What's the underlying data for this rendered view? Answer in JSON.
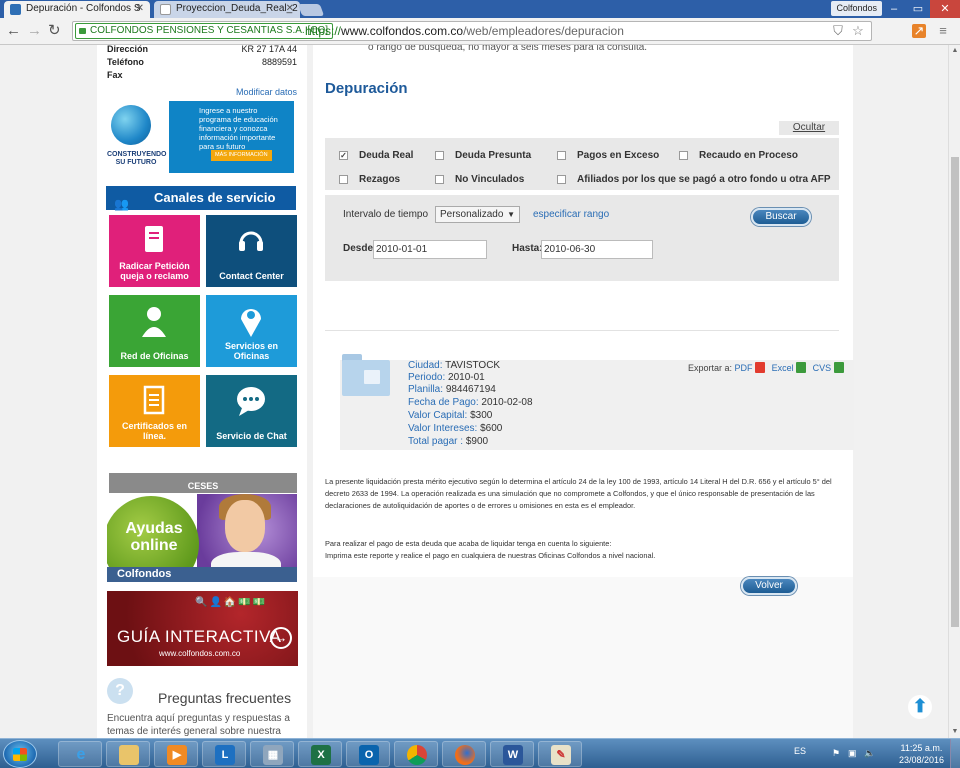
{
  "browser": {
    "tabs": [
      {
        "title": "Depuración - Colfondos S",
        "active": true
      },
      {
        "title": "Proyeccion_Deuda_Real_2",
        "active": false
      }
    ],
    "profile_name": "Colfondos",
    "ev_badge": "COLFONDOS PENSIONES Y CESANTIAS S.A. [CO]",
    "url_scheme": "https://",
    "url_host": "www.colfondos.com.co",
    "url_path": "/web/empleadores/depuracion"
  },
  "sidebar": {
    "info": [
      {
        "label": "Dirección",
        "value": "KR 27 17A 44"
      },
      {
        "label": "Teléfono",
        "value": "8889591"
      },
      {
        "label": "Fax",
        "value": ""
      }
    ],
    "modify_link": "Modificar datos",
    "edu_banner": {
      "caption": "CONSTRUYENDO SU FUTURO",
      "text": "Ingrese a nuestro programa de educación financiera y conozca información importante para su futuro",
      "more": "MÁS INFORMACIÓN"
    },
    "canales_title": "Canales de servicio",
    "tiles": [
      {
        "label": "Radicar Petición queja o reclamo",
        "color": "#e0207a"
      },
      {
        "label": "Contact Center",
        "color": "#0e4f7c"
      },
      {
        "label": "Red de Oficinas",
        "color": "#3aa535"
      },
      {
        "label": "Servicios en Oficinas",
        "color": "#1e9bd9"
      },
      {
        "label": "Certificados en línea.",
        "color": "#f49b0b"
      },
      {
        "label": "Servicio de Chat",
        "color": "#136a84"
      }
    ],
    "ceses_label": "CESES",
    "ayudas": {
      "title": "Ayudas online",
      "brand": "Colfondos"
    },
    "guia": {
      "title": "GUÍA INTERACTIVA",
      "url": "www.colfondos.com.co"
    },
    "faq": {
      "title": "Preguntas frecuentes",
      "text": "Encuentra aquí preguntas y respuestas a temas de interés general sobre nuestra"
    }
  },
  "content": {
    "cut_text": "o rango de búsqueda, no mayor a seis meses para la consulta.",
    "title": "Depuración",
    "hide_link": "Ocultar",
    "filters": [
      {
        "label": "Deuda Real",
        "checked": true
      },
      {
        "label": "Deuda Presunta",
        "checked": false
      },
      {
        "label": "Pagos en Exceso",
        "checked": false
      },
      {
        "label": "Recaudo en Proceso",
        "checked": false
      },
      {
        "label": "Rezagos",
        "checked": false
      },
      {
        "label": "No Vinculados",
        "checked": false
      },
      {
        "label": "Afiliados por los que se pagó a otro fondo u otra AFP",
        "checked": false
      }
    ],
    "interval_label": "Intervalo de tiempo",
    "interval_value": "Personalizado",
    "specify_range": "especificar rango",
    "search_button": "Buscar",
    "from_label": "Desde:",
    "from_value": "2010-01-01",
    "to_label": "Hasta:",
    "to_value": "2010-06-30",
    "result": [
      {
        "label": "Ciudad:",
        "value": "TAVISTOCK"
      },
      {
        "label": "Periodo:",
        "value": "2010-01"
      },
      {
        "label": "Planilla:",
        "value": "984467194"
      },
      {
        "label": "Fecha de Pago:",
        "value": "2010-02-08"
      },
      {
        "label": "Valor Capital:",
        "value": "$300"
      },
      {
        "label": "Valor Intereses:",
        "value": "$600"
      },
      {
        "label": "Total pagar :",
        "value": "$900"
      }
    ],
    "export_label": "Exportar a:",
    "export_formats": [
      "PDF",
      "Excel",
      "CVS"
    ],
    "legal_text": "La presente liquidación presta mérito ejecutivo según lo determina el artículo 24 de la ley 100 de 1993, artículo 14 Literal H del D.R. 656 y el artículo 5° del decreto 2633 de 1994. La operación realizada es una simulación que no compromete a Colfondos, y que el único responsable de presentación de las declaraciones de autoliquidación de aportes o de errores u omisiones en esta es el empleador.",
    "payment_line1": "Para realizar el pago de esta deuda que acaba de liquidar tenga en cuenta lo siguiente:",
    "payment_line2": "Imprima este reporte y realice el pago en cualquiera de nuestras Oficinas Colfondos a nivel nacional.",
    "back_button": "Volver"
  },
  "taskbar": {
    "language": "ES",
    "time": "11:25 a.m.",
    "date": "23/08/2016"
  }
}
